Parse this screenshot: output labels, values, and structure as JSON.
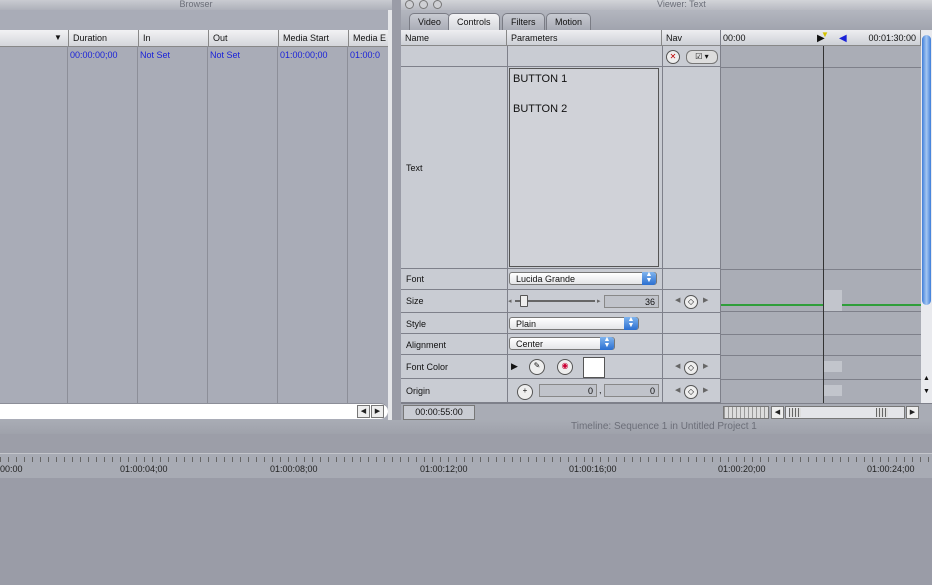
{
  "browser": {
    "title": "Browser",
    "columns": [
      "",
      "Duration",
      "In",
      "Out",
      "Media Start",
      "Media E"
    ],
    "row": {
      "duration": "00:00:00;00",
      "in": "Not Set",
      "out": "Not Set",
      "media_start": "01:00:00;00",
      "media_end": "01:00:0"
    }
  },
  "viewer": {
    "title": "Viewer: Text",
    "tabs": [
      "Video",
      "Controls",
      "Filters",
      "Motion"
    ],
    "active_tab": "Controls",
    "headers": {
      "name": "Name",
      "parameters": "Parameters",
      "nav": "Nav"
    },
    "ruler": {
      "start": "00:00",
      "end": "00:01:30:00"
    },
    "text_label": "Text",
    "text_lines": [
      "BUTTON 1",
      "BUTTON 2"
    ],
    "params": {
      "font": {
        "label": "Font",
        "value": "Lucida Grande"
      },
      "size": {
        "label": "Size",
        "value": "36",
        "slider_fraction": 0.1
      },
      "style": {
        "label": "Style",
        "value": "Plain"
      },
      "alignment": {
        "label": "Alignment",
        "value": "Center"
      },
      "font_color": {
        "label": "Font Color",
        "value": "#ffffff"
      },
      "origin": {
        "label": "Origin",
        "x": "0",
        "y": "0"
      }
    },
    "timecode": "00:00:55:00"
  },
  "timeline": {
    "title": "Timeline: Sequence 1 in Untitled Project 1",
    "ruler_labels": [
      "00:00",
      "01:00:04;00",
      "01:00:08;00",
      "01:00:12;00",
      "01:00:16;00",
      "01:00:20;00",
      "01:00:24;00"
    ]
  },
  "colors": {
    "link_blue": "#1a22d8",
    "accent_blue": "#2b6fd1",
    "keyframe_green": "#2f9e3a"
  }
}
